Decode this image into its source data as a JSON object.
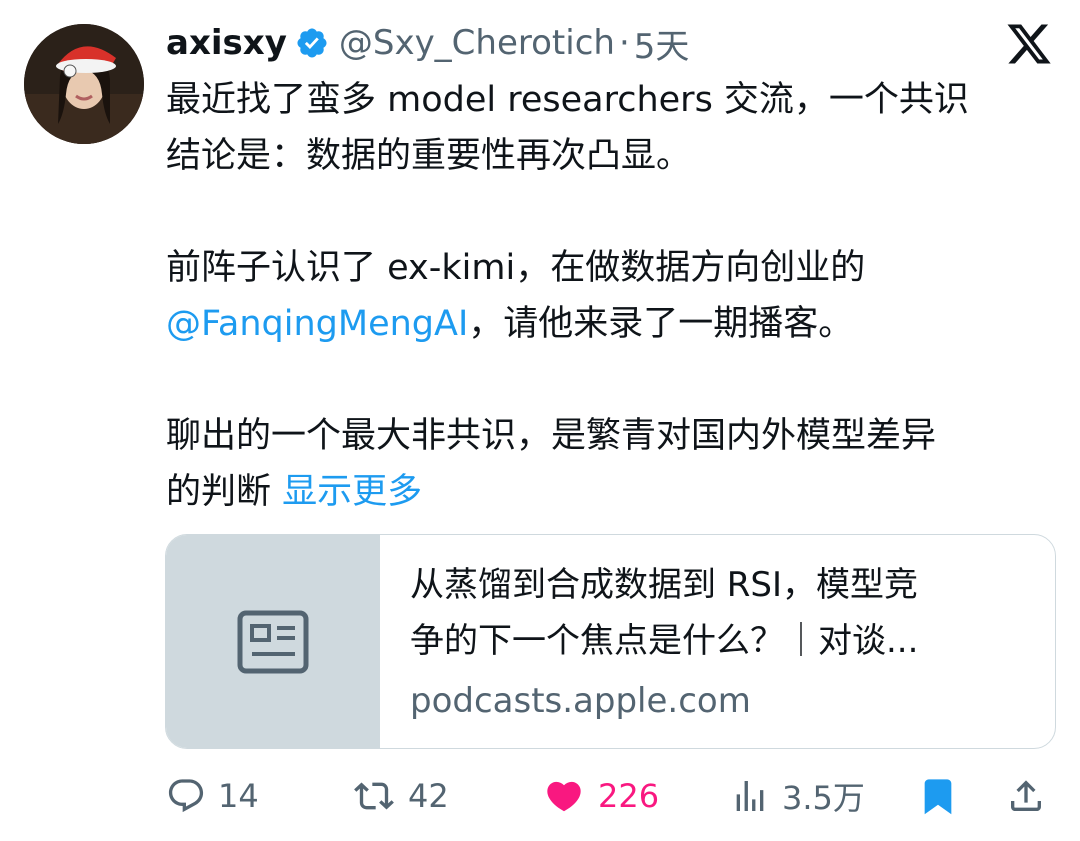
{
  "tweet": {
    "display_name": "axisxy",
    "handle": "@Sxy_Cherotich",
    "separator": "·",
    "time": "5天",
    "body": {
      "line1": "最近找了蛮多 model researchers 交流，一个共识",
      "line2": "结论是：数据的重要性再次凸显。",
      "line3": "前阵子认识了 ex-kimi，在做数据方向创业的",
      "mention": "@FanqingMengAI",
      "line4_rest": "，请他来录了一期播客。",
      "line5": "聊出的一个最大非共识，是繁青对国内外模型差异",
      "line6": "的判断",
      "show_more": "显示更多"
    },
    "card": {
      "title_line1": "从蒸馏到合成数据到 RSI，模型竞",
      "title_line2": "争的下一个焦点是什么？｜对谈...",
      "domain": "podcasts.apple.com",
      "thumbnail_icon": "article-icon"
    },
    "actions": {
      "replies": "14",
      "retweets": "42",
      "likes": "226",
      "views": "3.5万"
    }
  },
  "icons": {
    "verified": "verified-badge-icon",
    "logo": "x-logo-icon",
    "reply": "reply-icon",
    "retweet": "retweet-icon",
    "like": "heart-icon",
    "views": "views-icon",
    "bookmark": "bookmark-icon",
    "share": "share-icon"
  },
  "colors": {
    "text": "#0f1419",
    "secondary": "#536471",
    "link": "#1d9bf0",
    "like": "#f91880",
    "bookmark": "#1d9bf0",
    "card_border": "#cfd9de",
    "card_thumb": "#cfd9de"
  }
}
